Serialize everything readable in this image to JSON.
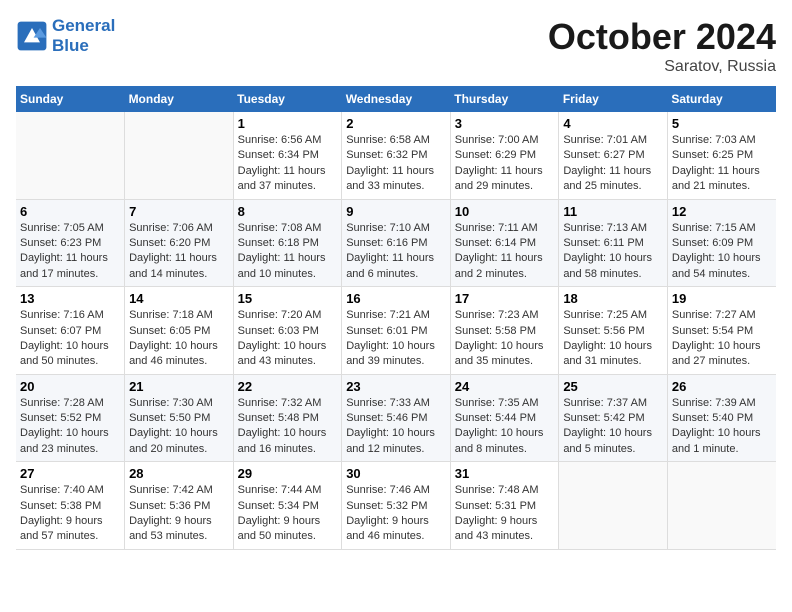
{
  "header": {
    "logo_line1": "General",
    "logo_line2": "Blue",
    "month": "October 2024",
    "location": "Saratov, Russia"
  },
  "weekdays": [
    "Sunday",
    "Monday",
    "Tuesday",
    "Wednesday",
    "Thursday",
    "Friday",
    "Saturday"
  ],
  "weeks": [
    [
      {
        "day": "",
        "info": ""
      },
      {
        "day": "",
        "info": ""
      },
      {
        "day": "1",
        "info": "Sunrise: 6:56 AM\nSunset: 6:34 PM\nDaylight: 11 hours and 37 minutes."
      },
      {
        "day": "2",
        "info": "Sunrise: 6:58 AM\nSunset: 6:32 PM\nDaylight: 11 hours and 33 minutes."
      },
      {
        "day": "3",
        "info": "Sunrise: 7:00 AM\nSunset: 6:29 PM\nDaylight: 11 hours and 29 minutes."
      },
      {
        "day": "4",
        "info": "Sunrise: 7:01 AM\nSunset: 6:27 PM\nDaylight: 11 hours and 25 minutes."
      },
      {
        "day": "5",
        "info": "Sunrise: 7:03 AM\nSunset: 6:25 PM\nDaylight: 11 hours and 21 minutes."
      }
    ],
    [
      {
        "day": "6",
        "info": "Sunrise: 7:05 AM\nSunset: 6:23 PM\nDaylight: 11 hours and 17 minutes."
      },
      {
        "day": "7",
        "info": "Sunrise: 7:06 AM\nSunset: 6:20 PM\nDaylight: 11 hours and 14 minutes."
      },
      {
        "day": "8",
        "info": "Sunrise: 7:08 AM\nSunset: 6:18 PM\nDaylight: 11 hours and 10 minutes."
      },
      {
        "day": "9",
        "info": "Sunrise: 7:10 AM\nSunset: 6:16 PM\nDaylight: 11 hours and 6 minutes."
      },
      {
        "day": "10",
        "info": "Sunrise: 7:11 AM\nSunset: 6:14 PM\nDaylight: 11 hours and 2 minutes."
      },
      {
        "day": "11",
        "info": "Sunrise: 7:13 AM\nSunset: 6:11 PM\nDaylight: 10 hours and 58 minutes."
      },
      {
        "day": "12",
        "info": "Sunrise: 7:15 AM\nSunset: 6:09 PM\nDaylight: 10 hours and 54 minutes."
      }
    ],
    [
      {
        "day": "13",
        "info": "Sunrise: 7:16 AM\nSunset: 6:07 PM\nDaylight: 10 hours and 50 minutes."
      },
      {
        "day": "14",
        "info": "Sunrise: 7:18 AM\nSunset: 6:05 PM\nDaylight: 10 hours and 46 minutes."
      },
      {
        "day": "15",
        "info": "Sunrise: 7:20 AM\nSunset: 6:03 PM\nDaylight: 10 hours and 43 minutes."
      },
      {
        "day": "16",
        "info": "Sunrise: 7:21 AM\nSunset: 6:01 PM\nDaylight: 10 hours and 39 minutes."
      },
      {
        "day": "17",
        "info": "Sunrise: 7:23 AM\nSunset: 5:58 PM\nDaylight: 10 hours and 35 minutes."
      },
      {
        "day": "18",
        "info": "Sunrise: 7:25 AM\nSunset: 5:56 PM\nDaylight: 10 hours and 31 minutes."
      },
      {
        "day": "19",
        "info": "Sunrise: 7:27 AM\nSunset: 5:54 PM\nDaylight: 10 hours and 27 minutes."
      }
    ],
    [
      {
        "day": "20",
        "info": "Sunrise: 7:28 AM\nSunset: 5:52 PM\nDaylight: 10 hours and 23 minutes."
      },
      {
        "day": "21",
        "info": "Sunrise: 7:30 AM\nSunset: 5:50 PM\nDaylight: 10 hours and 20 minutes."
      },
      {
        "day": "22",
        "info": "Sunrise: 7:32 AM\nSunset: 5:48 PM\nDaylight: 10 hours and 16 minutes."
      },
      {
        "day": "23",
        "info": "Sunrise: 7:33 AM\nSunset: 5:46 PM\nDaylight: 10 hours and 12 minutes."
      },
      {
        "day": "24",
        "info": "Sunrise: 7:35 AM\nSunset: 5:44 PM\nDaylight: 10 hours and 8 minutes."
      },
      {
        "day": "25",
        "info": "Sunrise: 7:37 AM\nSunset: 5:42 PM\nDaylight: 10 hours and 5 minutes."
      },
      {
        "day": "26",
        "info": "Sunrise: 7:39 AM\nSunset: 5:40 PM\nDaylight: 10 hours and 1 minute."
      }
    ],
    [
      {
        "day": "27",
        "info": "Sunrise: 7:40 AM\nSunset: 5:38 PM\nDaylight: 9 hours and 57 minutes."
      },
      {
        "day": "28",
        "info": "Sunrise: 7:42 AM\nSunset: 5:36 PM\nDaylight: 9 hours and 53 minutes."
      },
      {
        "day": "29",
        "info": "Sunrise: 7:44 AM\nSunset: 5:34 PM\nDaylight: 9 hours and 50 minutes."
      },
      {
        "day": "30",
        "info": "Sunrise: 7:46 AM\nSunset: 5:32 PM\nDaylight: 9 hours and 46 minutes."
      },
      {
        "day": "31",
        "info": "Sunrise: 7:48 AM\nSunset: 5:31 PM\nDaylight: 9 hours and 43 minutes."
      },
      {
        "day": "",
        "info": ""
      },
      {
        "day": "",
        "info": ""
      }
    ]
  ]
}
